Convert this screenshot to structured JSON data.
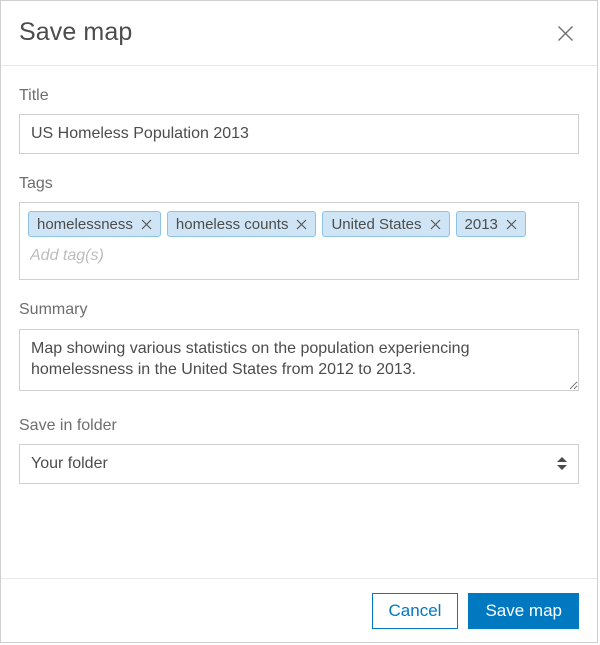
{
  "dialog": {
    "title": "Save map",
    "close_icon": "close-icon"
  },
  "title_field": {
    "label": "Title",
    "value": "US Homeless Population 2013",
    "placeholder": ""
  },
  "tags_field": {
    "label": "Tags",
    "placeholder": "Add tag(s)",
    "input_value": "",
    "remove_icon": "close-icon",
    "tags": [
      {
        "label": "homelessness"
      },
      {
        "label": "homeless counts"
      },
      {
        "label": "United States"
      },
      {
        "label": "2013"
      }
    ]
  },
  "summary_field": {
    "label": "Summary",
    "value": "Map showing various statistics on the population experiencing homelessness in the United States from 2012 to 2013.",
    "placeholder": ""
  },
  "folder_field": {
    "label": "Save in folder",
    "selected": "Your folder",
    "options": [
      "Your folder"
    ],
    "stepper_icon": "chevron-updown-icon"
  },
  "footer": {
    "cancel_label": "Cancel",
    "save_label": "Save map"
  },
  "colors": {
    "accent": "#0079c1",
    "tag_background": "#cfe5f5",
    "tag_border": "#8fc3e6",
    "border": "#cfcfcf",
    "text": "#4c4c4c",
    "label_text": "#6e6e6e",
    "placeholder": "#bdbdbd"
  }
}
